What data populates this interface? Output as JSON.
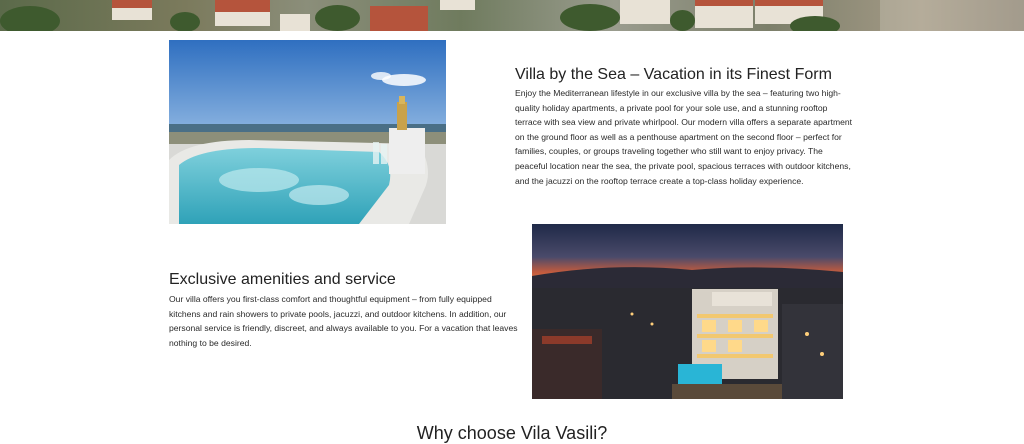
{
  "hero": {
    "alt": "Aerial view of the town rooftops"
  },
  "section_1": {
    "image_alt": "Rooftop jacuzzi with sea view and champagne",
    "title": "Villa by the Sea – Vacation in its Finest Form",
    "text": "Enjoy the Mediterranean lifestyle in our exclusive villa by the sea – featuring two high-quality holiday apartments, a private pool for your sole use, and a stunning rooftop terrace with sea view and private whirlpool. Our modern villa offers a separate apartment on the ground floor as well as a penthouse apartment on the second floor – perfect for families, couples, or groups traveling together who still want to enjoy privacy. The peaceful location near the sea, the private pool, spacious terraces with outdoor kitchens, and the jacuzzi on the rooftop terrace create a top-class holiday experience."
  },
  "section_2": {
    "image_alt": "Villa illuminated at dusk with lit pool",
    "title": "Exclusive amenities and service",
    "text": "Our villa offers you first-class comfort and thoughtful equipment – from fully equipped kitchens and rain showers to private pools, jacuzzi, and outdoor kitchens. In addition, our personal service is friendly, discreet, and always available to you. For a vacation that leaves nothing to be desired."
  },
  "why": {
    "title": "Why choose Vila Vasili?"
  }
}
